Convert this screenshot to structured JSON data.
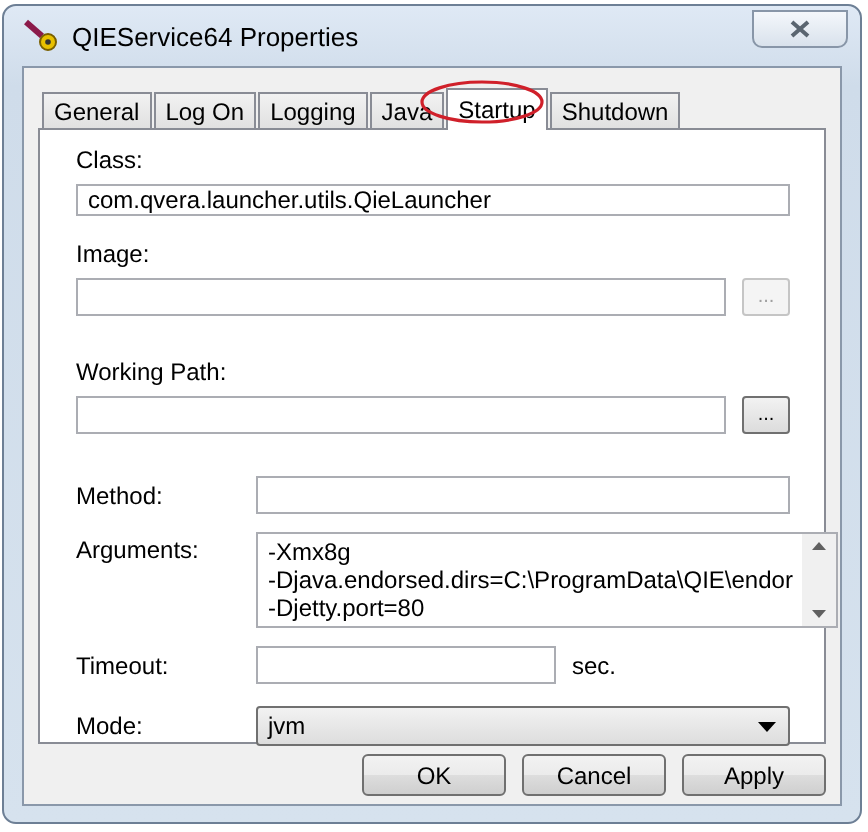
{
  "window": {
    "title": "QIEService64 Properties"
  },
  "tabs": [
    {
      "label": "General",
      "selected": false
    },
    {
      "label": "Log On",
      "selected": false
    },
    {
      "label": "Logging",
      "selected": false
    },
    {
      "label": "Java",
      "selected": false
    },
    {
      "label": "Startup",
      "selected": true
    },
    {
      "label": "Shutdown",
      "selected": false
    }
  ],
  "fields": [
    {
      "kind": "stacked",
      "label": "Class:",
      "value": "com.qvera.launcher.utils.QieLauncher"
    },
    {
      "kind": "browse",
      "label": "Image:",
      "browse": {
        "label": "...",
        "disabled": true
      }
    },
    {
      "kind": "browse",
      "label": "Working Path:",
      "browse": {
        "label": "...",
        "disabled": false
      }
    },
    {
      "kind": "inline",
      "label": "Method:"
    },
    {
      "kind": "multiline",
      "label": "Arguments:",
      "lines": [
        "-Xmx8g",
        "-Djava.endorsed.dirs=C:\\ProgramData\\QIE\\endor",
        "-Djetty.port=80"
      ]
    },
    {
      "kind": "unit",
      "label": "Timeout:",
      "unit": "sec."
    },
    {
      "kind": "select",
      "label": "Mode:",
      "value": "jvm"
    }
  ],
  "buttons": [
    "OK",
    "Cancel",
    "Apply"
  ]
}
